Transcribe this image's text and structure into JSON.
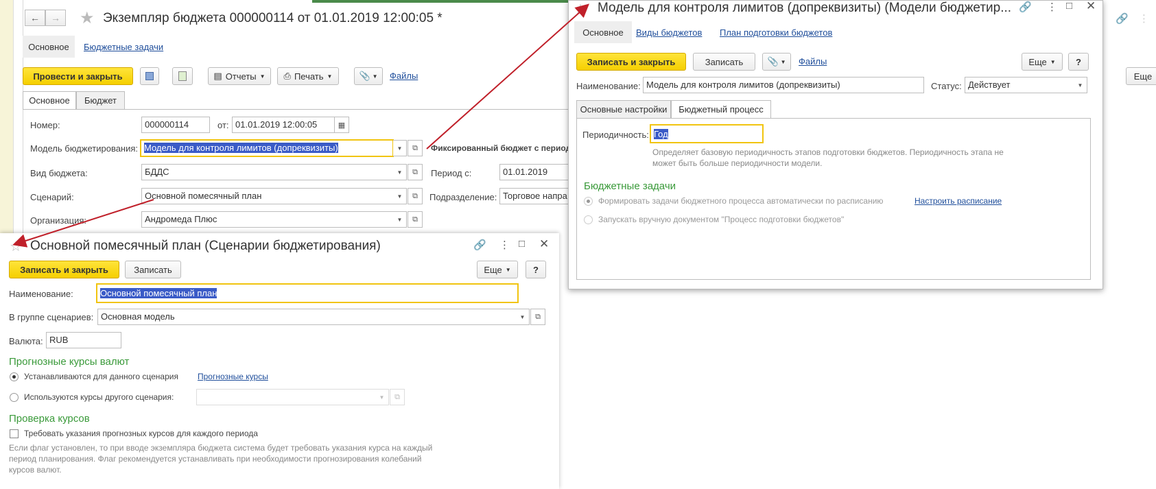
{
  "budget_window": {
    "title": "Экземпляр бюджета 000000114 от 01.01.2019 12:00:05 *",
    "nav_tabs": [
      "Основное",
      "Бюджетные задачи"
    ],
    "toolbar": {
      "post_close": "Провести и закрыть",
      "reports": "Отчеты",
      "print": "Печать",
      "files": "Файлы"
    },
    "tabs": [
      "Основное",
      "Бюджет"
    ],
    "fields": {
      "number_label": "Номер:",
      "number_value": "000000114",
      "from_label": "от:",
      "date_value": "01.01.2019 12:00:05",
      "model_label": "Модель бюджетирования:",
      "model_value": "Модель для контроля лимитов (допреквизиты)",
      "type_label": "Вид бюджета:",
      "type_value": "БДДС",
      "scenario_label": "Сценарий:",
      "scenario_value": "Основной помесячный план",
      "org_label": "Организация:",
      "org_value": "Андромеда Плюс",
      "fixed_budget": "Фиксированный бюджет с период",
      "period_label": "Период с:",
      "period_value": "01.01.2019",
      "division_label": "Подразделение:",
      "division_value": "Торговое напра"
    }
  },
  "model_window": {
    "title": "Модель для контроля лимитов (допреквизиты) (Модели бюджетир...",
    "nav_tabs": [
      "Основное",
      "Виды бюджетов",
      "План подготовки бюджетов"
    ],
    "toolbar": {
      "save_close": "Записать и закрыть",
      "save": "Записать",
      "files": "Файлы",
      "more": "Еще",
      "help": "?"
    },
    "name_label": "Наименование:",
    "name_value": "Модель для контроля лимитов (допреквизиты)",
    "status_label": "Статус:",
    "status_value": "Действует",
    "tabs": [
      "Основные настройки",
      "Бюджетный процесс"
    ],
    "periodicity_label": "Периодичность:",
    "periodicity_value": "Год",
    "periodicity_note": "Определяет базовую периодичность этапов подготовки бюджетов. Периодичность этапа не может быть больше периодичности модели.",
    "tasks_section": "Бюджетные задачи",
    "radio_auto": "Формировать задачи бюджетного процесса автоматически по расписанию",
    "schedule_link": "Настроить расписание",
    "radio_manual": "Запускать вручную документом \"Процесс подготовки бюджетов\""
  },
  "scenario_window": {
    "title": "Основной помесячный план (Сценарии бюджетирования)",
    "toolbar": {
      "save_close": "Записать и закрыть",
      "save": "Записать",
      "more": "Еще",
      "help": "?"
    },
    "name_label": "Наименование:",
    "name_value": "Основной помесячный план",
    "group_label": "В группе сценариев:",
    "group_value": "Основная модель",
    "currency_label": "Валюта:",
    "currency_value": "RUB",
    "rates_section": "Прогнозные курсы валют",
    "radio_this": "Устанавливаются для данного сценария",
    "rates_link": "Прогнозные курсы",
    "radio_other": "Используются курсы другого сценария:",
    "check_section": "Проверка курсов",
    "check_label": "Требовать указания прогнозных курсов для каждого периода",
    "check_note": "Если флаг установлен, то при вводе экземпляра бюджета система будет требовать указания курса на каждый период планирования. Флаг рекомендуется устанавливать при необходимости прогнозирования колебаний курсов валют."
  },
  "background": {
    "more": "Еще"
  },
  "colors": {
    "accent_yellow": "#f5cf00",
    "link_blue": "#1f4e9b",
    "section_green": "#3a9a3a",
    "arrow_red": "#c0202a"
  }
}
